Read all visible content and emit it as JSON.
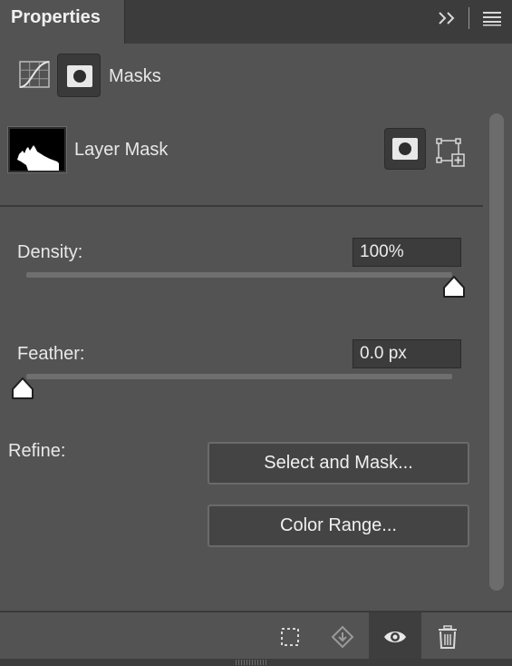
{
  "panel": {
    "tab_title": "Properties"
  },
  "type_bar": {
    "label": "Masks"
  },
  "layer": {
    "label": "Layer Mask"
  },
  "density": {
    "label": "Density:",
    "value": "100%",
    "fraction": 1.0
  },
  "feather": {
    "label": "Feather:",
    "value": "0.0 px",
    "fraction": 0.0
  },
  "refine": {
    "label": "Refine:",
    "select_and_mask": "Select and Mask...",
    "color_range": "Color Range..."
  },
  "colors": {
    "panel_bg": "#535353",
    "tab_bg": "#3c3c3c",
    "field_bg": "#3c3c3c",
    "button_bg": "#444444"
  },
  "icons": {
    "collapse": "double-chevron-right-icon",
    "menu": "hamburger-menu-icon",
    "curves": "curves-adjustment-icon",
    "pixel_mask": "pixel-mask-icon",
    "vector_mask": "vector-mask-icon",
    "load_selection": "load-selection-icon",
    "apply_mask": "apply-mask-icon",
    "visibility": "eye-icon",
    "delete": "trash-icon"
  }
}
